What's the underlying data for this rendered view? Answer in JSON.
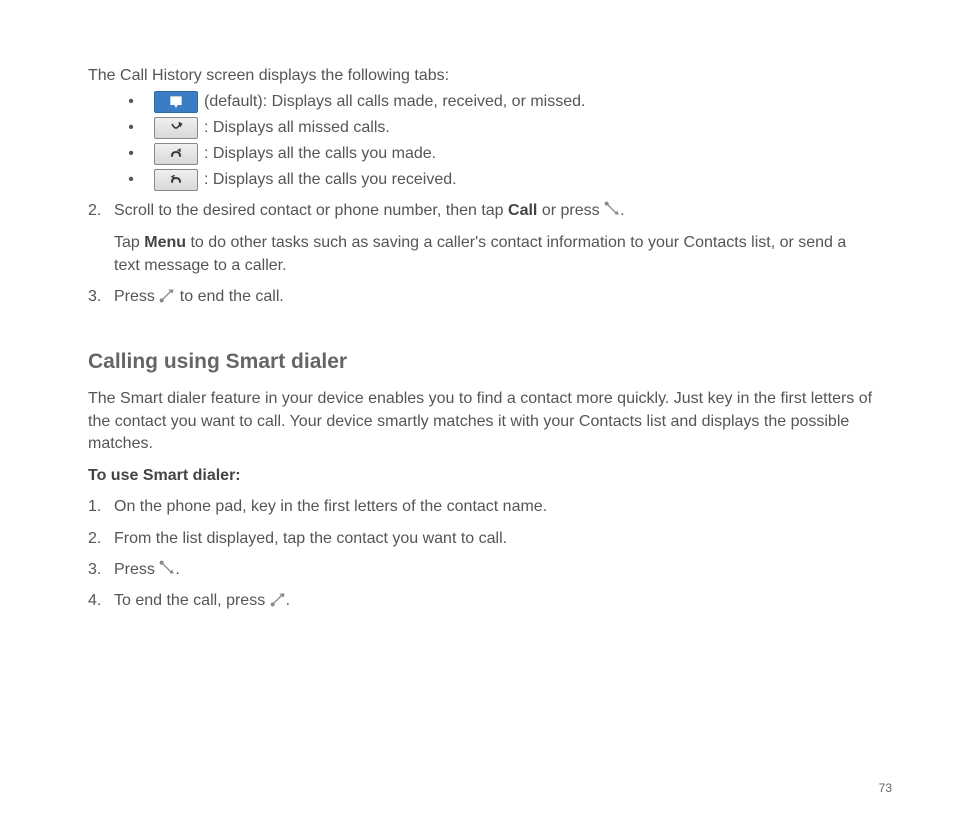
{
  "intro": "The Call History screen displays the following tabs:",
  "tabs": [
    {
      "desc": " (default): Displays all calls made, received, or missed."
    },
    {
      "desc": ": Displays all missed calls."
    },
    {
      "desc": ": Displays all the calls you made."
    },
    {
      "desc": ": Displays all the calls you received."
    }
  ],
  "step2": {
    "num": "2.",
    "t1a": "Scroll to the desired contact or phone number, then tap ",
    "call": "Call",
    "t1b": " or press ",
    "t1c": ".",
    "t2a": "Tap ",
    "menu": "Menu",
    "t2b": " to do other tasks such as saving a caller's contact information to your Contacts list, or send a text message to a caller."
  },
  "step3": {
    "num": "3.",
    "t1": "Press ",
    "t2": " to end the call."
  },
  "section_title": "Calling using Smart dialer",
  "section_intro": "The Smart dialer feature in your device enables you to find a contact more quickly. Just key in the first letters of the contact you want to call. Your device smartly matches it with your Contacts list and displays the possible matches.",
  "howto_title": "To use Smart dialer:",
  "howto": {
    "s1": {
      "num": "1.",
      "t": "On the phone pad, key in the first letters of the contact name."
    },
    "s2": {
      "num": "2.",
      "t": "From the list displayed, tap the contact you want to call."
    },
    "s3": {
      "num": "3.",
      "t1": "Press ",
      "t2": "."
    },
    "s4": {
      "num": "4.",
      "t1": "To end the call, press ",
      "t2": "."
    }
  },
  "page_number": "73"
}
